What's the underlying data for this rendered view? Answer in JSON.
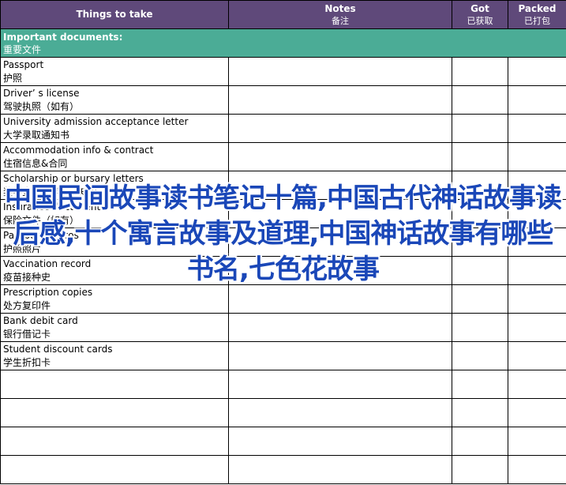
{
  "header": {
    "things": "Things to take",
    "notes_en": "Notes",
    "notes_zh": "备注",
    "got_en": "Got",
    "got_zh": "已获取",
    "packed_en": "Packed",
    "packed_zh": "已打包"
  },
  "section": {
    "en": "Important documents:",
    "zh": "重要文件"
  },
  "items": [
    {
      "en": "Passport",
      "zh": "护照"
    },
    {
      "en": "Driver’ s license",
      "zh": "驾驶执照（如有）"
    },
    {
      "en": "University admission acceptance letter",
      "zh": "大学录取通知书"
    },
    {
      "en": "Accommodation info & contract",
      "zh": "住宿信息&合同"
    },
    {
      "en": "Scholarship or bursary letters",
      "zh": "奖学金或助学金通知书"
    },
    {
      "en": "Insurance documents",
      "zh": "保险文件（如有）"
    },
    {
      "en": "Passport photos",
      "zh": "护照照片"
    },
    {
      "en": "Vaccination record",
      "zh": "疫苗接种史"
    },
    {
      "en": "Prescription copies",
      "zh": "处方复印件"
    },
    {
      "en": "Bank debit card",
      "zh": "银行借记卡"
    },
    {
      "en": "Student discount cards",
      "zh": "学生折扣卡"
    }
  ],
  "overlay_text": "中国民间故事读书笔记十篇,中国古代神话故事读后感,十个寓言故事及道理,中国神话故事有哪些书名,七色花故事"
}
